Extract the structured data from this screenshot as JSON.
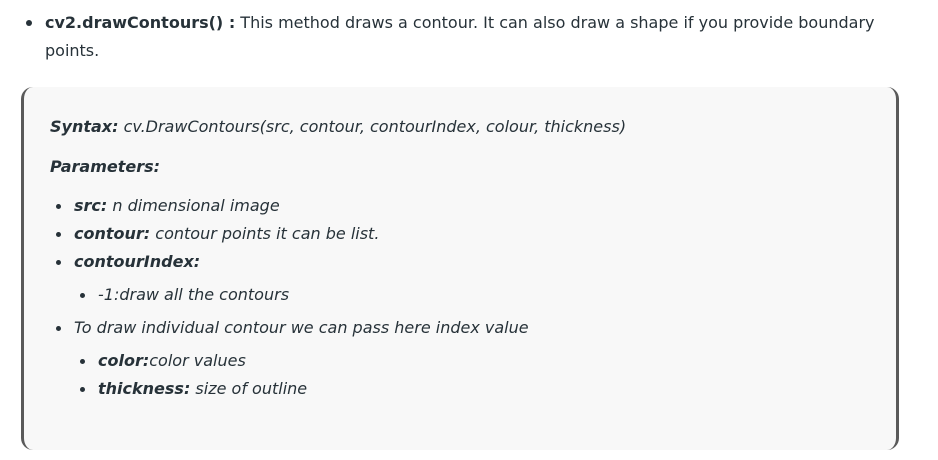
{
  "intro": {
    "method": "cv2.drawContours() :",
    "description": " This method draws a contour. It can also draw a shape if you provide boundary points."
  },
  "syntax": {
    "label": "Syntax:",
    "value": " cv.DrawContours(src, contour, contourIndex, colour, thickness)"
  },
  "parameters_label": "Parameters:",
  "params": {
    "src_label": "src:",
    "src_value": " n dimensional image",
    "contour_label": "contour:",
    "contour_value": " contour points it can be list.",
    "contourIndex_label": "contourIndex:",
    "contourIndex_sub": "-1:draw all the contours",
    "individual": "To draw individual contour we can pass here index value",
    "color_label": "color:",
    "color_value": "color values",
    "thickness_label": "thickness:",
    "thickness_value": " size of outline"
  }
}
